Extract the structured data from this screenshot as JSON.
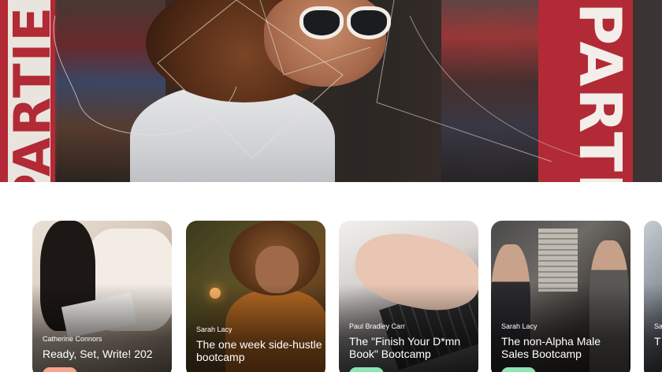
{
  "hero": {
    "sign_left": "PARTIE",
    "sign_right": "PARTI"
  },
  "cards": [
    {
      "author": "Catherine Connors",
      "title": "Ready, Set, Write! 202",
      "chip_color": "#f6a58c"
    },
    {
      "author": "Sarah Lacy",
      "title": "The one week side-hustle bootcamp",
      "chip_color": ""
    },
    {
      "author": "Paul Bradley Carr",
      "title": "The \"Finish Your D*mn Book\" Bootcamp",
      "chip_color": "#8fe3b4"
    },
    {
      "author": "Sarah Lacy",
      "title": "The non-Alpha Male Sales Bootcamp",
      "chip_color": "#8fe3b4"
    },
    {
      "author": "Sa",
      "title": "T B",
      "chip_color": ""
    }
  ]
}
